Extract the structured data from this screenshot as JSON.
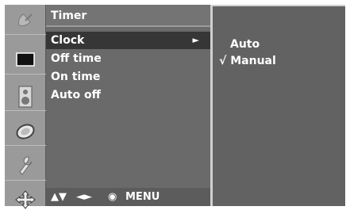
{
  "menu": {
    "title": "Timer",
    "items": [
      {
        "label": "Clock",
        "has_submenu_arrow": "►"
      },
      {
        "label": "Off time"
      },
      {
        "label": "On time"
      },
      {
        "label": "Auto off"
      }
    ],
    "selected_index": 0
  },
  "footer": {
    "nav_updown": "▲▼",
    "nav_leftright": "◄►",
    "ok_symbol": "◉",
    "menu_label": "MENU"
  },
  "submenu": {
    "options": [
      {
        "label": "Auto",
        "mark": ""
      },
      {
        "label": "Manual",
        "mark": "√"
      }
    ]
  },
  "sidebar": {
    "icons": [
      "satellite-dish-icon",
      "picture-screen-icon",
      "speaker-icon",
      "clock-icon",
      "wrench-icon",
      "cross-arrows-icon"
    ]
  },
  "colors": {
    "panel": "#6a6a6a",
    "selected_row": "#363636",
    "sidebar": "#9a9a9a",
    "submenu": "#626262",
    "text": "#ffffff"
  }
}
